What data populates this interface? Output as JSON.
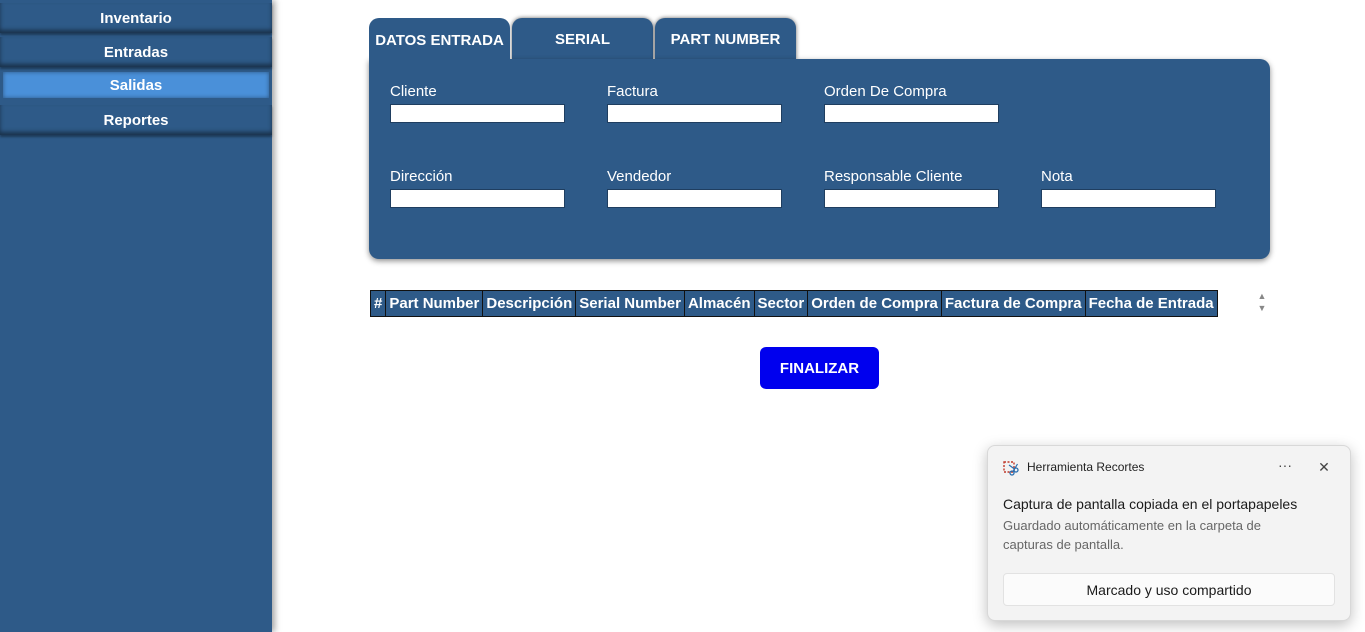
{
  "sidebar": {
    "items": [
      {
        "label": "Inventario"
      },
      {
        "label": "Entradas"
      },
      {
        "label": "Salidas",
        "active": true
      },
      {
        "label": "Reportes"
      }
    ]
  },
  "tabs": [
    {
      "label": "DATOS ENTRADA",
      "active": true
    },
    {
      "label": "SERIAL"
    },
    {
      "label": "PART NUMBER"
    }
  ],
  "form": {
    "fields": [
      {
        "label": "Cliente",
        "value": ""
      },
      {
        "label": "Factura",
        "value": ""
      },
      {
        "label": "Orden De Compra",
        "value": ""
      },
      {
        "label": "Dirección",
        "value": ""
      },
      {
        "label": "Vendedor",
        "value": ""
      },
      {
        "label": "Responsable Cliente",
        "value": ""
      },
      {
        "label": "Nota",
        "value": ""
      }
    ]
  },
  "table": {
    "columns": [
      "#",
      "Part Number",
      "Descripción",
      "Serial Number",
      "Almacén",
      "Sector",
      "Orden de Compra",
      "Factura de Compra",
      "Fecha de Entrada"
    ],
    "rows": []
  },
  "actions": {
    "finalizar": "FINALIZAR"
  },
  "toast": {
    "app_name": "Herramienta Recortes",
    "more": "···",
    "close": "✕",
    "title": "Captura de pantalla copiada en el portapapeles",
    "body": "Guardado automáticamente en la carpeta de capturas de pantalla.",
    "action": "Marcado y uso compartido"
  },
  "colors": {
    "primary": "#2e5a88",
    "active_nav": "#4a90d9",
    "finalize": "#0000ee"
  }
}
